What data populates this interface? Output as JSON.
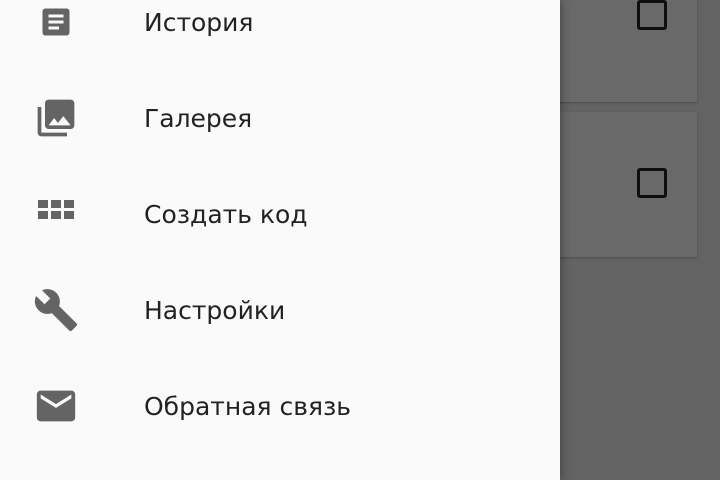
{
  "drawer": {
    "items": [
      {
        "label": "История",
        "icon": "history-icon"
      },
      {
        "label": "Галерея",
        "icon": "gallery-icon"
      },
      {
        "label": "Создать код",
        "icon": "grid-icon"
      },
      {
        "label": "Настройки",
        "icon": "wrench-icon"
      },
      {
        "label": "Обратная связь",
        "icon": "mail-icon"
      }
    ]
  },
  "colors": {
    "drawer_bg": "#fafafa",
    "icon": "#646464",
    "text": "#222222",
    "scrim": "rgba(0,0,0,0.58)"
  }
}
